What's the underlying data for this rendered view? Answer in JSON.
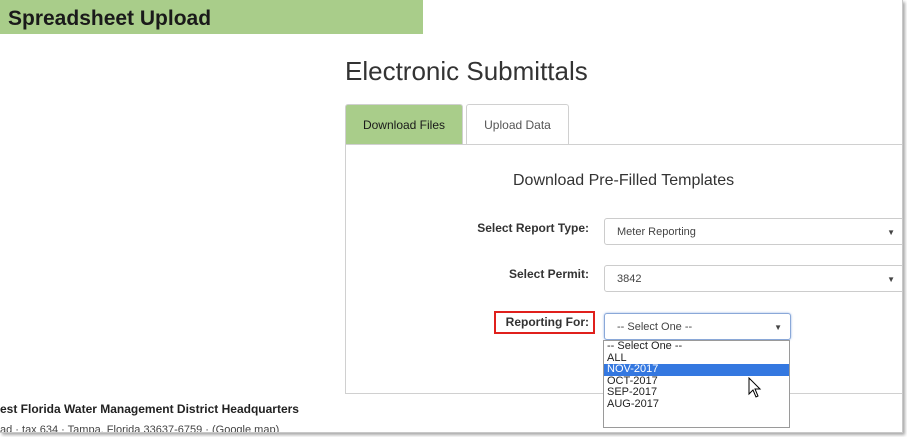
{
  "banner": {
    "title": "Spreadsheet Upload"
  },
  "page": {
    "title": "Electronic Submittals"
  },
  "tabs": [
    {
      "label": "Download Files",
      "active": true
    },
    {
      "label": "Upload Data",
      "active": false
    }
  ],
  "panel": {
    "heading": "Download Pre-Filled Templates",
    "report_type": {
      "label": "Select Report Type:",
      "value": "Meter Reporting"
    },
    "permit": {
      "label": "Select Permit:",
      "value": "3842"
    },
    "reporting_for": {
      "label": "Reporting For:",
      "value": "-- Select One --",
      "options": [
        "-- Select One --",
        "ALL",
        "NOV-2017",
        "OCT-2017",
        "SEP-2017",
        "AUG-2017"
      ],
      "highlighted": "NOV-2017"
    }
  },
  "footer": {
    "hq": "est Florida Water Management District Headquarters",
    "address": "ad · tax 634 · Tampa, Florida 33637-6759 · (Google map)"
  },
  "colors": {
    "banner_bg": "#a9cd8a",
    "active_tab_bg": "#a9cd8a",
    "highlight_box": "#e0201c",
    "option_selected": "#3478e0"
  }
}
